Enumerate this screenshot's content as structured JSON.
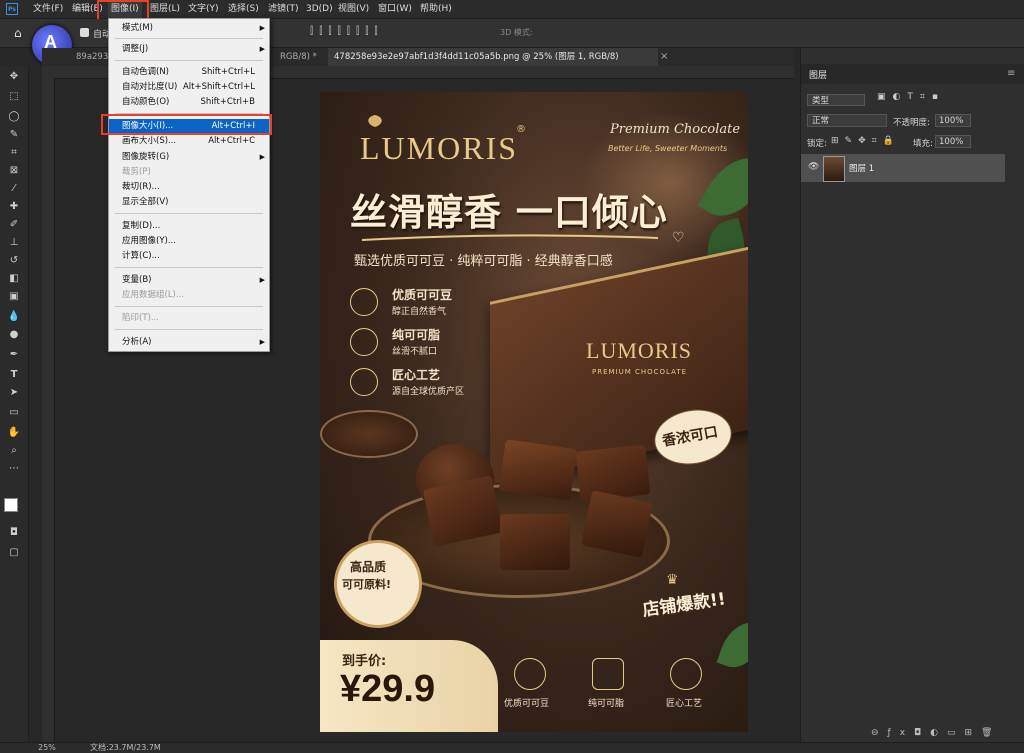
{
  "menubar": {
    "items": [
      "文件(F)",
      "编辑(E)",
      "图像(I)",
      "图层(L)",
      "文字(Y)",
      "选择(S)",
      "滤镜(T)",
      "3D(D)",
      "视图(V)",
      "窗口(W)",
      "帮助(H)"
    ],
    "active_index": 2
  },
  "optionsbar": {
    "autoselect_label": "自动",
    "mode_3d_label": "3D 模式:"
  },
  "tabs": [
    {
      "label": "89a293f7..."
    },
    {
      "label": "RGB/8) *"
    },
    {
      "label": "478258e93e2e97abf1d3f4dd11c05a5b.png @ 25% (图层 1, RGB/8)"
    }
  ],
  "image_menu": {
    "items": [
      {
        "label": "模式(M)",
        "submenu": true
      },
      {
        "label": "调整(J)",
        "submenu": true
      },
      {
        "label": "自动色调(N)",
        "shortcut": "Shift+Ctrl+L"
      },
      {
        "label": "自动对比度(U)",
        "shortcut": "Alt+Shift+Ctrl+L"
      },
      {
        "label": "自动颜色(O)",
        "shortcut": "Shift+Ctrl+B"
      },
      {
        "label": "图像大小(I)...",
        "shortcut": "Alt+Ctrl+I",
        "highlighted": true
      },
      {
        "label": "画布大小(S)...",
        "shortcut": "Alt+Ctrl+C"
      },
      {
        "label": "图像旋转(G)",
        "submenu": true
      },
      {
        "label": "裁剪(P)",
        "disabled": true
      },
      {
        "label": "裁切(R)..."
      },
      {
        "label": "显示全部(V)"
      },
      {
        "label": "复制(D)..."
      },
      {
        "label": "应用图像(Y)..."
      },
      {
        "label": "计算(C)..."
      },
      {
        "label": "变量(B)",
        "submenu": true
      },
      {
        "label": "应用数据组(L)...",
        "disabled": true
      },
      {
        "label": "陷印(T)...",
        "disabled": true
      },
      {
        "label": "分析(A)",
        "submenu": true
      }
    ]
  },
  "poster": {
    "brand": "LUMORIS",
    "registered": "®",
    "premium_title": "Premium Chocolate",
    "premium_sub": "Better Life, Sweeter Moments",
    "headline": "丝滑醇香 一口倾心",
    "subheadline": "甄选优质可可豆 · 纯粹可可脂 · 经典醇香口感",
    "features": [
      {
        "title": "优质可可豆",
        "desc": "醇正自然香气"
      },
      {
        "title": "纯可可脂",
        "desc": "丝滑不腻口"
      },
      {
        "title": "匠心工艺",
        "desc": "源自全球优质产区"
      }
    ],
    "box_brand": "LUMORIS",
    "box_sub": "PREMIUM CHOCOLATE",
    "bubble": "香浓可口",
    "badge": [
      "高品质",
      "可可原料!"
    ],
    "store_hot": "店铺爆款!!",
    "price_label": "到手价:",
    "price_value": "¥29.9",
    "bottom_icons": [
      "优质可可豆",
      "纯可可脂",
      "匠心工艺"
    ]
  },
  "layers_panel": {
    "tab": "图层",
    "filter": "类型",
    "blend_mode": "正常",
    "opacity_label": "不透明度:",
    "opacity_value": "100%",
    "lock_label": "锁定:",
    "fill_label": "填充:",
    "fill_value": "100%",
    "layer_name": "图层 1"
  },
  "status": {
    "zoom": "25%",
    "doc": "文档:23.7M/23.7M"
  }
}
